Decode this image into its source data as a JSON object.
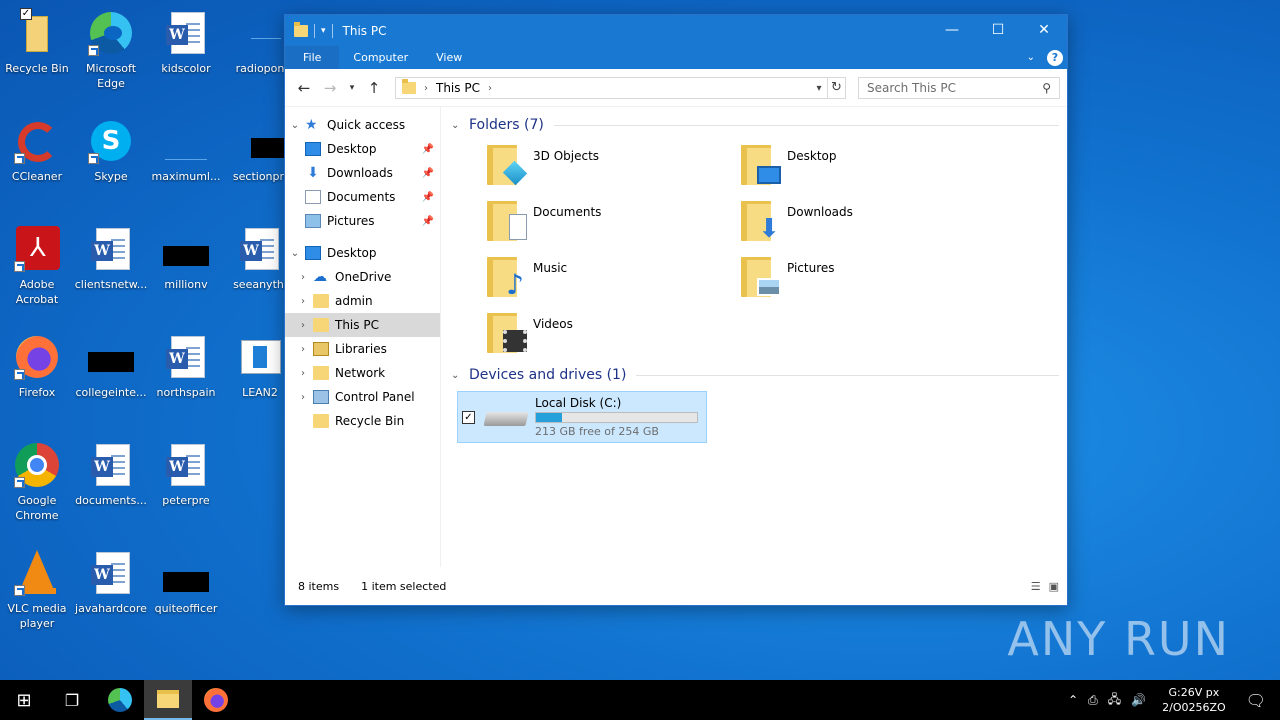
{
  "desktop": {
    "icons": [
      {
        "label": "Recycle Bin"
      },
      {
        "label": "Microsoft Edge"
      },
      {
        "label": "kidscolor"
      },
      {
        "label": "radiopon"
      },
      {
        "label": "CCleaner"
      },
      {
        "label": "Skype"
      },
      {
        "label": "maximuml..."
      },
      {
        "label": "sectionpri"
      },
      {
        "label": "Adobe Acrobat"
      },
      {
        "label": "clientsnetw..."
      },
      {
        "label": "millionv"
      },
      {
        "label": "seeanythi"
      },
      {
        "label": "Firefox"
      },
      {
        "label": "collegeinte..."
      },
      {
        "label": "northspain"
      },
      {
        "label": "LEAN2"
      },
      {
        "label": "Google Chrome"
      },
      {
        "label": "documents..."
      },
      {
        "label": "peterpre"
      },
      {
        "label": "VLC media player"
      },
      {
        "label": "javahardcore"
      },
      {
        "label": "quiteofficer"
      }
    ]
  },
  "window": {
    "title": "This PC",
    "controls": {
      "minimize": "—",
      "maximize": "☐",
      "close": "✕"
    },
    "ribbon_tabs": [
      "File",
      "Computer",
      "View"
    ],
    "help": "?",
    "address": {
      "crumb": "This PC"
    },
    "search_placeholder": "Search This PC",
    "nav": {
      "quick_access": "Quick access",
      "qa_items": [
        "Desktop",
        "Downloads",
        "Documents",
        "Pictures"
      ],
      "desktop": "Desktop",
      "desktop_items": [
        "OneDrive",
        "admin",
        "This PC",
        "Libraries",
        "Network",
        "Control Panel",
        "Recycle Bin"
      ]
    },
    "folders_header": "Folders (7)",
    "folders": [
      "3D Objects",
      "Desktop",
      "Documents",
      "Downloads",
      "Music",
      "Pictures",
      "Videos"
    ],
    "drives_header": "Devices and drives (1)",
    "drive": {
      "name": "Local Disk (C:)",
      "free_text": "213 GB free of 254 GB",
      "used_fraction": 0.16
    },
    "status": {
      "items": "8 items",
      "selected": "1 item selected"
    }
  },
  "taskbar": {
    "clock_time": "G:26V px",
    "clock_date": "2/O0256ZO"
  },
  "watermark": "ANY RUN"
}
